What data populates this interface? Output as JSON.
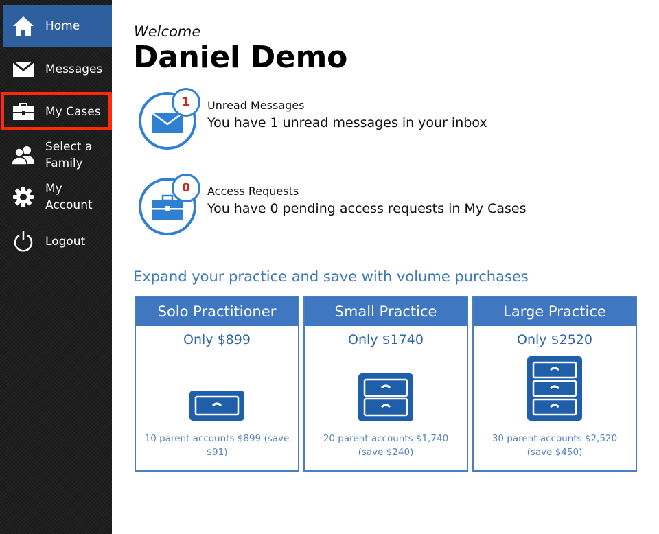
{
  "sidebar": {
    "items": [
      {
        "label": "Home",
        "icon": "home-icon",
        "active": true
      },
      {
        "label": "Messages",
        "icon": "envelope-icon"
      },
      {
        "label": "My Cases",
        "icon": "briefcase-icon",
        "highlighted": true
      },
      {
        "label": "Select a Family",
        "icon": "family-icon"
      },
      {
        "label": "My Account",
        "icon": "gear-icon"
      },
      {
        "label": "Logout",
        "icon": "power-icon"
      }
    ]
  },
  "header": {
    "welcome": "Welcome",
    "user_name": "Daniel Demo"
  },
  "notifications": [
    {
      "icon": "envelope-icon",
      "count": "1",
      "title": "Unread Messages",
      "description": "You have 1 unread messages in your inbox"
    },
    {
      "icon": "briefcase-icon",
      "count": "0",
      "title": "Access Requests",
      "description": "You have 0 pending access requests in My Cases"
    }
  ],
  "promo": {
    "heading": "Expand your practice and save with volume purchases",
    "plans": [
      {
        "name": "Solo Practitioner",
        "price": "Only $899",
        "icon": "file-cabinet-icon",
        "description": "10 parent accounts $899 (save $91)"
      },
      {
        "name": "Small Practice",
        "price": "Only $1740",
        "icon": "file-cabinet-icon",
        "description": "20 parent accounts $1,740 (save $240)"
      },
      {
        "name": "Large Practice",
        "price": "Only $2520",
        "icon": "file-cabinet-icon",
        "description": "30 parent accounts $2,520 (save $450)"
      }
    ]
  },
  "colors": {
    "sidebar_bg": "#1e1e1e",
    "active_nav": "#2e5f9e",
    "highlight": "#ff2a0c",
    "accent_blue": "#2f7fd3",
    "plan_header": "#3f78c0",
    "badge_text": "#d4231b"
  }
}
